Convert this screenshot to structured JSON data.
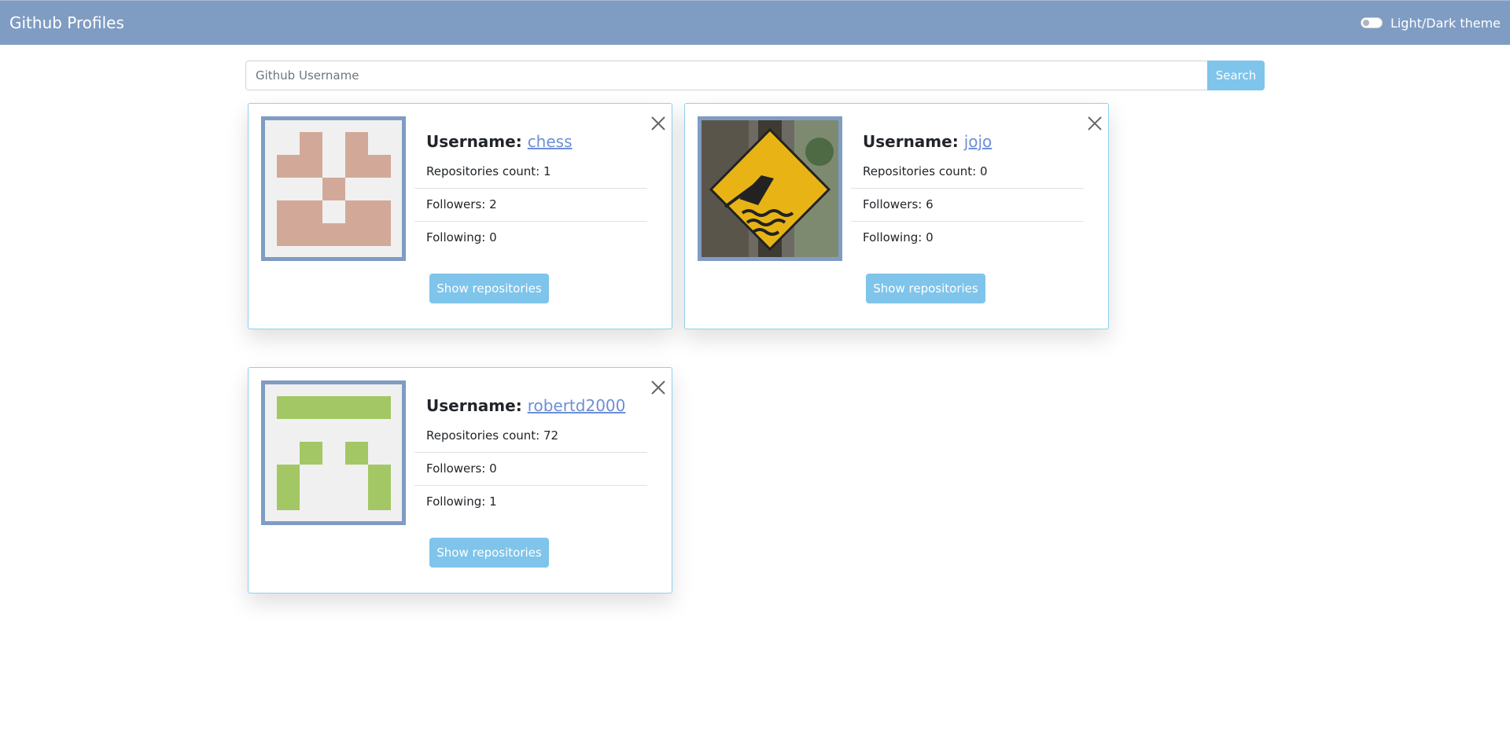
{
  "navbar": {
    "brand": "Github Profiles",
    "theme_label": "Light/Dark theme"
  },
  "search": {
    "placeholder": "Github Username",
    "value": "",
    "button_label": "Search"
  },
  "cards": [
    {
      "username_label": "Username:",
      "username": "chess",
      "repos": "Repositories count: 1",
      "followers": "Followers: 2",
      "following": "Following: 0",
      "button": "Show repositories",
      "avatar_color": "#d2a999"
    },
    {
      "username_label": "Username:",
      "username": "jojo",
      "repos": "Repositories count: 0",
      "followers": "Followers: 6",
      "following": "Following: 0",
      "button": "Show repositories",
      "avatar_color": "#f0c419"
    },
    {
      "username_label": "Username:",
      "username": "robertd2000",
      "repos": "Repositories count: 72",
      "followers": "Followers: 0",
      "following": "Following: 1",
      "button": "Show repositories",
      "avatar_color": "#a3c764"
    }
  ],
  "colors": {
    "navbar": "#7f9cc3",
    "button": "#7fc4ea",
    "card_border": "#8fd0f0",
    "link": "#6d8fd6"
  }
}
